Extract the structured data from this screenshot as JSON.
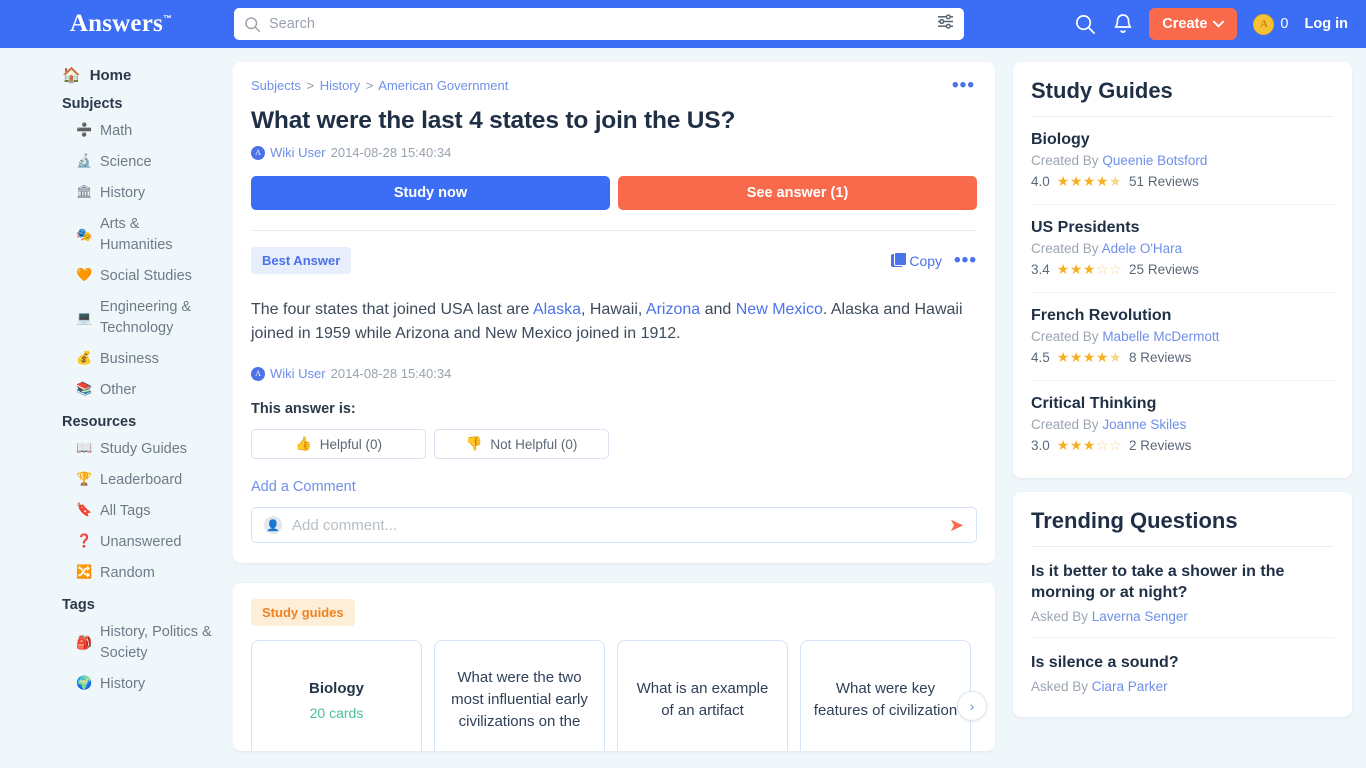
{
  "header": {
    "brand": "Answers",
    "brand_tm": "™",
    "search_placeholder": "Search",
    "search_value": "",
    "create_label": "Create",
    "coin_count": "0",
    "coin_glyph": "A",
    "login_label": "Log in"
  },
  "sidebar": {
    "home": {
      "label": "Home",
      "icon": "🏠"
    },
    "subjects_head": "Subjects",
    "subjects": [
      {
        "label": "Math",
        "icon": "➗"
      },
      {
        "label": "Science",
        "icon": "🔬"
      },
      {
        "label": "History",
        "icon": "🏛"
      },
      {
        "label": "Arts & Humanities",
        "icon": "🎭"
      },
      {
        "label": "Social Studies",
        "icon": "🧡"
      },
      {
        "label": "Engineering & Technology",
        "icon": "💻"
      },
      {
        "label": "Business",
        "icon": "💰"
      },
      {
        "label": "Other",
        "icon": "📚"
      }
    ],
    "resources_head": "Resources",
    "resources": [
      {
        "label": "Study Guides",
        "icon": "📖"
      },
      {
        "label": "Leaderboard",
        "icon": "🏆"
      },
      {
        "label": "All Tags",
        "icon": "🔖"
      },
      {
        "label": "Unanswered",
        "icon": "❓"
      },
      {
        "label": "Random",
        "icon": "🔀"
      }
    ],
    "tags_head": "Tags",
    "tags": [
      {
        "label": "History, Politics & Society",
        "icon": "🎒"
      },
      {
        "label": "History",
        "icon": "🌍"
      }
    ]
  },
  "question": {
    "breadcrumb": [
      "Subjects",
      "History",
      "American Government"
    ],
    "breadcrumb_sep": ">",
    "title": "What were the last 4 states to join the US?",
    "author": "Wiki User",
    "date": "2014-08-28 15:40:34",
    "study_now_label": "Study now",
    "see_answer_label": "See answer (1)",
    "menu_dots": "•••"
  },
  "answer": {
    "best_badge": "Best Answer",
    "copy_label": "Copy",
    "menu_dots": "•••",
    "text_parts": [
      {
        "t": "The four states that joined USA last are ",
        "link": false
      },
      {
        "t": "Alaska",
        "link": true
      },
      {
        "t": ", Hawaii, ",
        "link": false
      },
      {
        "t": "Arizona",
        "link": true
      },
      {
        "t": " and ",
        "link": false
      },
      {
        "t": "New Mexico",
        "link": true
      },
      {
        "t": ". Alaska and Hawaii joined in 1959 while Arizona and New Mexico joined in 1912.",
        "link": false
      }
    ],
    "author": "Wiki User",
    "date": "2014-08-28 15:40:34",
    "this_answer_is": "This answer is:",
    "helpful_label": "Helpful (0)",
    "not_helpful_label": "Not Helpful (0)",
    "helpful_icon": "👍",
    "not_helpful_icon": "👎",
    "add_comment_link": "Add a Comment",
    "comment_placeholder": "Add comment...",
    "comment_value": "",
    "send_icon": "➤"
  },
  "study_guides_carousel": {
    "chip": "Study guides",
    "next_icon": "›",
    "tiles": [
      {
        "title": "Biology",
        "cards": "20 cards"
      },
      {
        "question": "What were the two most influential early civilizations on the"
      },
      {
        "question": "What is an example of an artifact"
      },
      {
        "question": "What were key features of civilization"
      }
    ]
  },
  "rail": {
    "study_guides_title": "Study Guides",
    "guides": [
      {
        "name": "Biology",
        "created_by_label": "Created By",
        "author": "Queenie Botsford",
        "rating": "4.0",
        "stars": 4,
        "half": true,
        "reviews": "51 Reviews"
      },
      {
        "name": "US Presidents",
        "created_by_label": "Created By",
        "author": "Adele O'Hara",
        "rating": "3.4",
        "stars": 3,
        "half": false,
        "reviews": "25 Reviews"
      },
      {
        "name": "French Revolution",
        "created_by_label": "Created By",
        "author": "Mabelle McDermott",
        "rating": "4.5",
        "stars": 4,
        "half": true,
        "reviews": "8 Reviews"
      },
      {
        "name": "Critical Thinking",
        "created_by_label": "Created By",
        "author": "Joanne Skiles",
        "rating": "3.0",
        "stars": 3,
        "half": false,
        "reviews": "2 Reviews"
      }
    ],
    "trending_title": "Trending Questions",
    "trending": [
      {
        "q": "Is it better to take a shower in the morning or at night?",
        "asked_label": "Asked By",
        "author": "Laverna Senger"
      },
      {
        "q": "Is silence a sound?",
        "asked_label": "Asked By",
        "author": "Ciara Parker"
      }
    ]
  },
  "colors": {
    "brand_blue": "#3b6ef5",
    "accent_orange": "#f96a4d",
    "page_bg": "#f0f7fb",
    "link_blue": "#4b72e8",
    "star_gold": "#f5b324"
  }
}
